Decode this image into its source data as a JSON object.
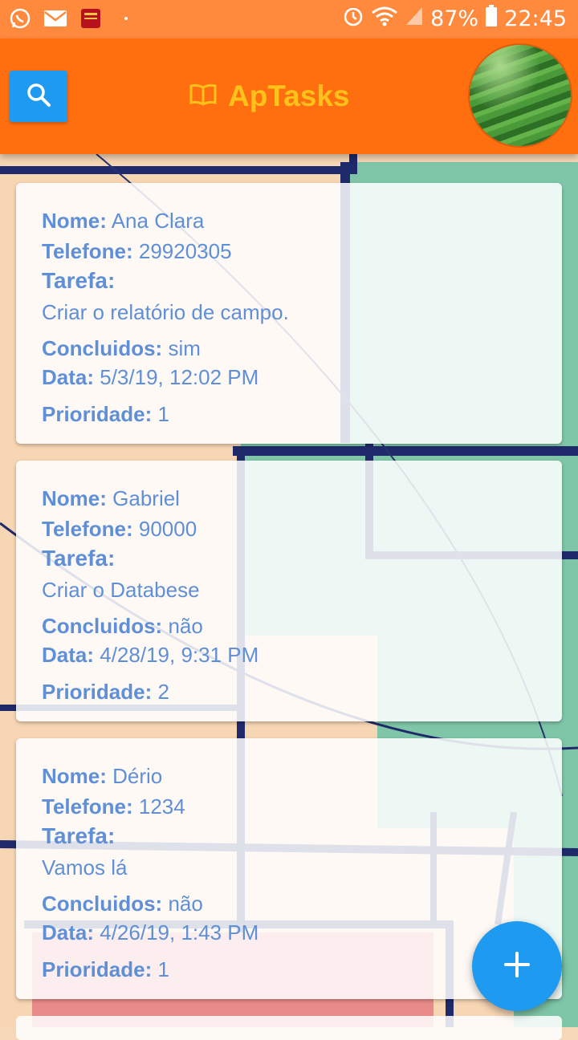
{
  "status_bar": {
    "battery": "87%",
    "time": "22:45",
    "icons": [
      "whatsapp-icon",
      "mail-icon",
      "book-app-icon",
      "dot-icon",
      "alarm-icon",
      "wifi-icon",
      "signal-icon",
      "battery-icon"
    ]
  },
  "app_bar": {
    "title": "ApTasks",
    "search_icon": "search-icon",
    "title_icon": "open-book-icon"
  },
  "labels": {
    "nome": "Nome:",
    "telefone": "Telefone:",
    "tarefa": "Tarefa:",
    "concluidos": "Concluidos:",
    "data": "Data:",
    "prioridade": "Prioridade:"
  },
  "tasks": [
    {
      "nome": "Ana Clara",
      "telefone": "29920305",
      "tarefa": "Criar o relatório de campo.",
      "concluidos": "sim",
      "data": "5/3/19, 12:02 PM",
      "prioridade": "1"
    },
    {
      "nome": "Gabriel",
      "telefone": "90000",
      "tarefa": "Criar o Databese",
      "concluidos": "não",
      "data": "4/28/19, 9:31 PM",
      "prioridade": "2"
    },
    {
      "nome": "Dério",
      "telefone": "1234",
      "tarefa": "Vamos lá",
      "concluidos": "não",
      "data": "4/26/19, 1:43 PM",
      "prioridade": "1"
    }
  ],
  "fab": {
    "icon": "plus-icon"
  },
  "colors": {
    "status_bar": "#ff8a3d",
    "app_bar": "#ff6f0f",
    "title": "#ffc21a",
    "accent": "#1e9bf0",
    "card_text": "#5f8fd6"
  }
}
